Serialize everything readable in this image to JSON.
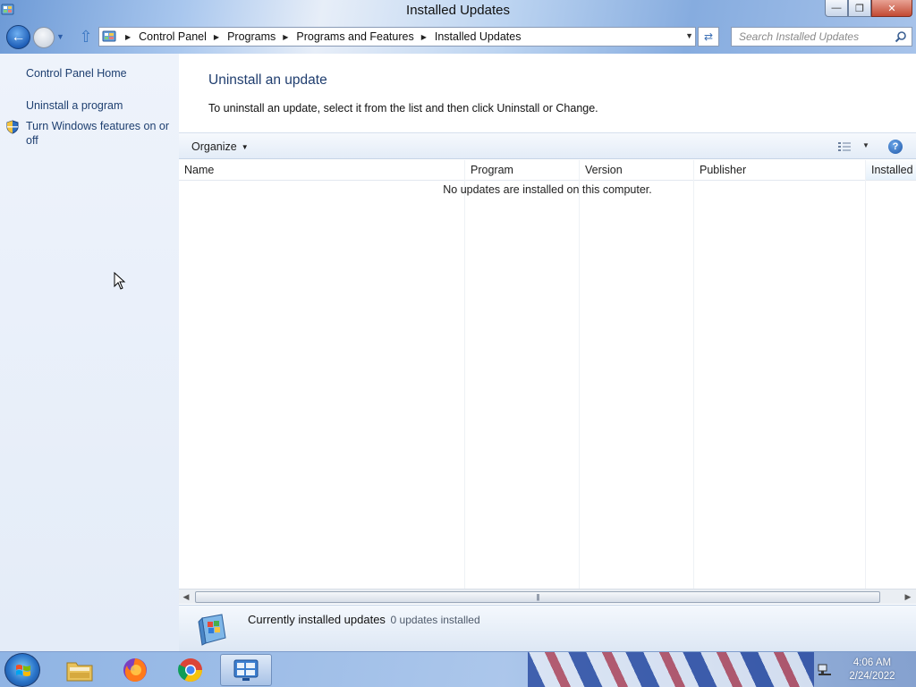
{
  "window": {
    "title": "Installed Updates",
    "controls": {
      "minimize": "minimize-icon",
      "maximize": "restore-icon",
      "close": "close-icon"
    }
  },
  "nav": {
    "breadcrumb": [
      "Control Panel",
      "Programs",
      "Programs and Features",
      "Installed Updates"
    ],
    "search_placeholder": "Search Installed Updates"
  },
  "sidebar": {
    "links": [
      {
        "label": "Control Panel Home"
      },
      {
        "label": "Uninstall a program"
      },
      {
        "label": "Turn Windows features on or off",
        "icon": "shield-icon"
      }
    ]
  },
  "main": {
    "heading": "Uninstall an update",
    "instructions": "To uninstall an update, select it from the list and then click Uninstall or Change.",
    "toolbar": {
      "organize_label": "Organize"
    },
    "columns": [
      "Name",
      "Program",
      "Version",
      "Publisher",
      "Installed On"
    ],
    "empty_message": "No updates are installed on this computer.",
    "details": {
      "label": "Currently installed updates",
      "count": "0 updates installed"
    }
  },
  "taskbar": {
    "apps": [
      "file-explorer-icon",
      "firefox-icon",
      "chrome-icon",
      "control-panel-icon"
    ],
    "clock": {
      "time": "4:06 AM",
      "date": "2/24/2022"
    }
  },
  "colors": {
    "link": "#1e3f70",
    "heading": "#1f3d6e",
    "accent": "#1f5fb8"
  }
}
